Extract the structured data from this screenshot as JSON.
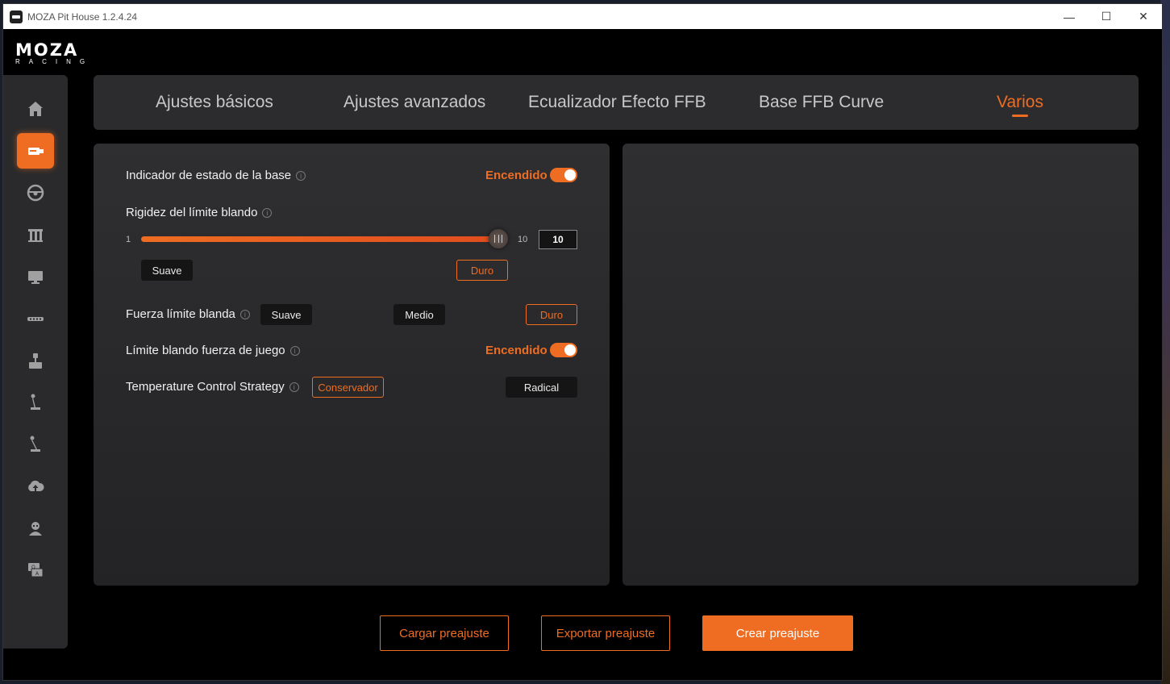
{
  "window": {
    "title": "MOZA Pit House 1.2.4.24",
    "controls": {
      "minimize": "—",
      "maximize": "☐",
      "close": "✕"
    }
  },
  "logo": {
    "main": "MOZA",
    "sub": "RACING"
  },
  "sidebar": {
    "items": [
      {
        "icon": "home-icon"
      },
      {
        "icon": "wheelbase-icon",
        "active": true
      },
      {
        "icon": "steering-wheel-icon"
      },
      {
        "icon": "pedals-icon"
      },
      {
        "icon": "dashboard-icon"
      },
      {
        "icon": "handbrake-strip-icon"
      },
      {
        "icon": "joystick-icon"
      },
      {
        "icon": "shifter-icon"
      },
      {
        "icon": "sequential-shifter-icon"
      },
      {
        "icon": "cloud-upload-icon"
      },
      {
        "icon": "user-icon"
      },
      {
        "icon": "faq-icon"
      }
    ]
  },
  "tabs": [
    {
      "label": "Ajustes básicos"
    },
    {
      "label": "Ajustes avanzados"
    },
    {
      "label": "Ecualizador Efecto FFB"
    },
    {
      "label": "Base FFB Curve"
    },
    {
      "label": "Varios",
      "active": true
    }
  ],
  "settings": {
    "status_indicator": {
      "label": "Indicador de estado de la base",
      "state": "Encendido",
      "on": true
    },
    "soft_limit_stiffness": {
      "label": "Rigidez del límite blando",
      "min": "1",
      "max": "10",
      "value": "10",
      "presets": [
        "Suave",
        "Duro"
      ],
      "selected": "Duro"
    },
    "soft_limit_force": {
      "label": "Fuerza límite blanda",
      "options": [
        "Suave",
        "Medio",
        "Duro"
      ],
      "selected": "Duro"
    },
    "game_force_soft_limit": {
      "label": "Límite blando fuerza de juego",
      "state": "Encendido",
      "on": true
    },
    "temperature_control": {
      "label": "Temperature Control Strategy",
      "options": [
        "Conservador",
        "Radical"
      ],
      "selected": "Conservador"
    }
  },
  "footer": {
    "load_preset": "Cargar preajuste",
    "export_preset": "Exportar preajuste",
    "create_preset": "Crear preajuste"
  },
  "colors": {
    "accent": "#ee6d22",
    "panel": "#2c2c2e",
    "background": "#000000"
  }
}
